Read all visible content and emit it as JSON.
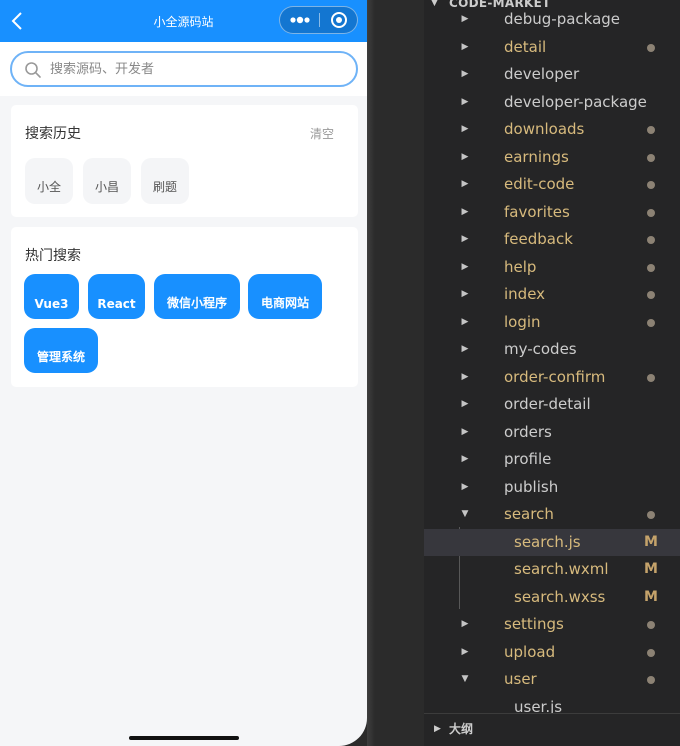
{
  "simulator": {
    "title": "小全源码站",
    "search_placeholder": "搜索源码、开发者",
    "history": {
      "title": "搜索历史",
      "clear_label": "清空",
      "items": [
        "小全",
        "小昌",
        "刷题"
      ]
    },
    "hot": {
      "title": "热门搜索",
      "items": [
        "Vue3",
        "React",
        "微信小程序",
        "电商网站",
        "管理系统"
      ]
    },
    "colors": {
      "accent": "#1890ff"
    }
  },
  "explorer": {
    "header": "CODE-MARKET",
    "rows": [
      {
        "name": "debug-package",
        "kind": "folder",
        "expanded": false,
        "modified": false
      },
      {
        "name": "detail",
        "kind": "folder",
        "expanded": false,
        "modified": true
      },
      {
        "name": "developer",
        "kind": "folder",
        "expanded": false,
        "modified": false
      },
      {
        "name": "developer-package",
        "kind": "folder",
        "expanded": false,
        "modified": false
      },
      {
        "name": "downloads",
        "kind": "folder",
        "expanded": false,
        "modified": true
      },
      {
        "name": "earnings",
        "kind": "folder",
        "expanded": false,
        "modified": true
      },
      {
        "name": "edit-code",
        "kind": "folder",
        "expanded": false,
        "modified": true
      },
      {
        "name": "favorites",
        "kind": "folder",
        "expanded": false,
        "modified": true
      },
      {
        "name": "feedback",
        "kind": "folder",
        "expanded": false,
        "modified": true
      },
      {
        "name": "help",
        "kind": "folder",
        "expanded": false,
        "modified": true
      },
      {
        "name": "index",
        "kind": "folder",
        "expanded": false,
        "modified": true
      },
      {
        "name": "login",
        "kind": "folder",
        "expanded": false,
        "modified": true
      },
      {
        "name": "my-codes",
        "kind": "folder",
        "expanded": false,
        "modified": false
      },
      {
        "name": "order-confirm",
        "kind": "folder",
        "expanded": false,
        "modified": true
      },
      {
        "name": "order-detail",
        "kind": "folder",
        "expanded": false,
        "modified": false
      },
      {
        "name": "orders",
        "kind": "folder",
        "expanded": false,
        "modified": false
      },
      {
        "name": "profile",
        "kind": "folder",
        "expanded": false,
        "modified": false
      },
      {
        "name": "publish",
        "kind": "folder",
        "expanded": false,
        "modified": false
      },
      {
        "name": "search",
        "kind": "folder",
        "expanded": true,
        "modified": true
      },
      {
        "name": "search.js",
        "kind": "file",
        "badge": "M",
        "selected": true
      },
      {
        "name": "search.wxml",
        "kind": "file",
        "badge": "M",
        "selected": false
      },
      {
        "name": "search.wxss",
        "kind": "file",
        "badge": "M",
        "selected": false
      },
      {
        "name": "settings",
        "kind": "folder",
        "expanded": false,
        "modified": true
      },
      {
        "name": "upload",
        "kind": "folder",
        "expanded": false,
        "modified": true
      },
      {
        "name": "user",
        "kind": "folder",
        "expanded": true,
        "modified": true
      },
      {
        "name": "user.js",
        "kind": "file",
        "badge": "",
        "selected": false
      }
    ],
    "outline_label": "大纲",
    "colors": {
      "modified": "#d7ba7d",
      "plain": "#cccccc",
      "dot": "#8c8274"
    }
  }
}
